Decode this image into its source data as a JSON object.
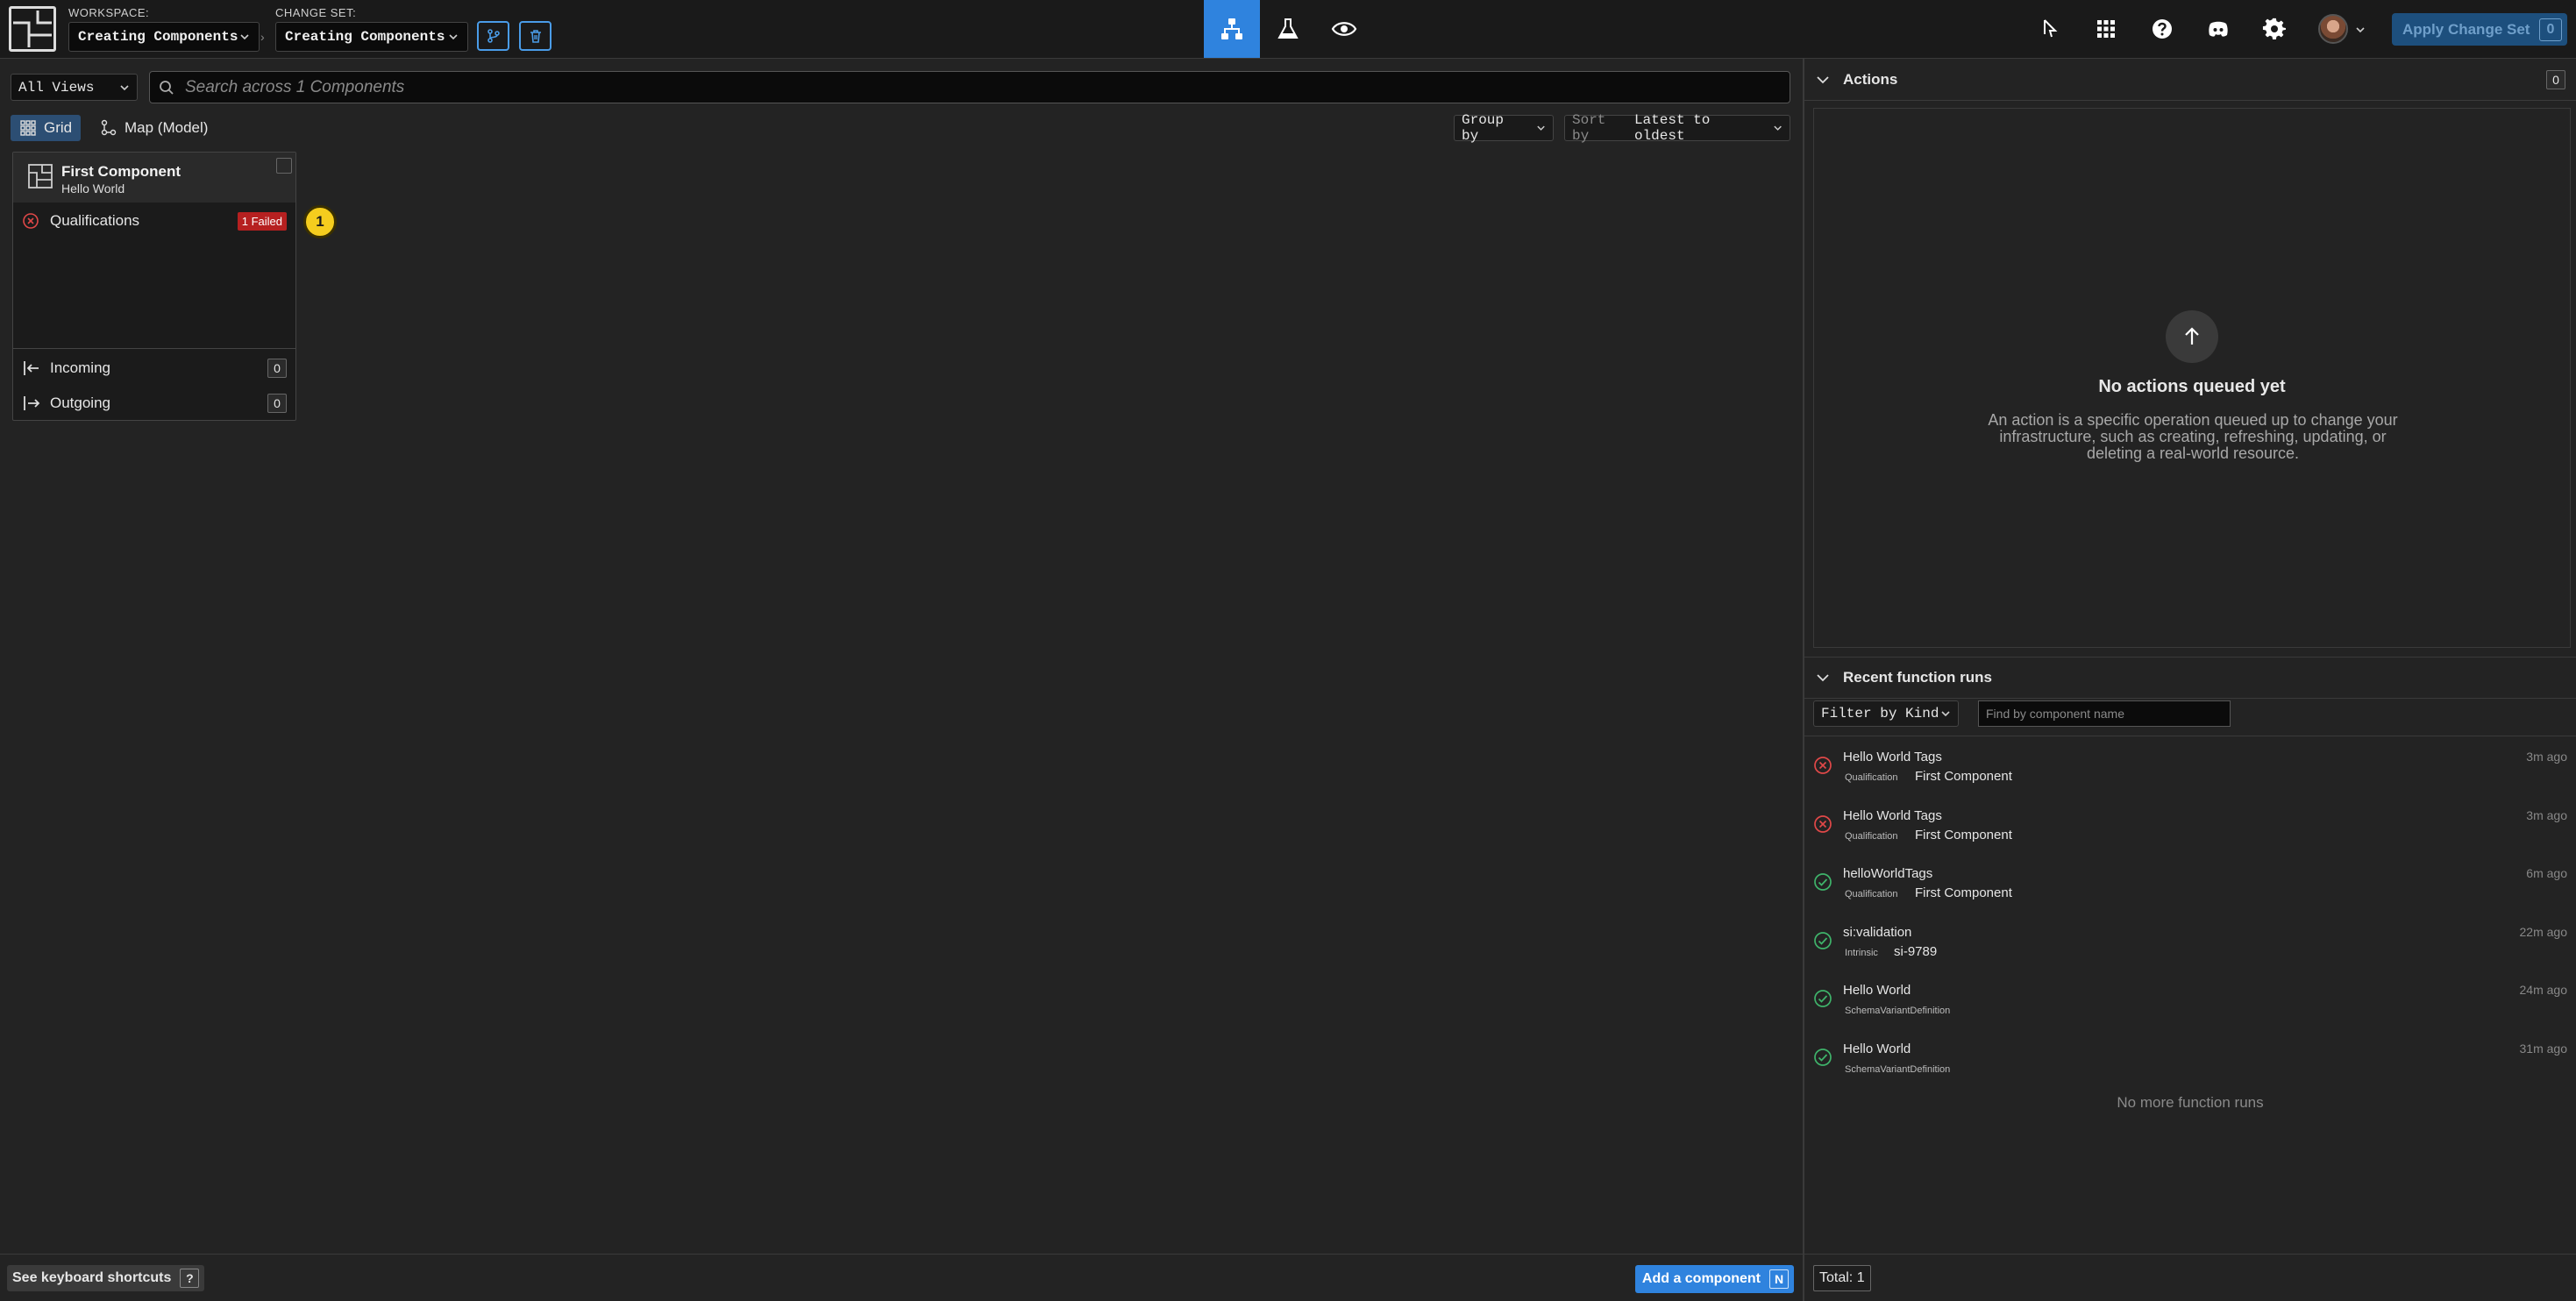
{
  "header": {
    "workspace_label": "WORKSPACE:",
    "workspace_value": "Creating Components",
    "changeset_label": "CHANGE SET:",
    "changeset_value": "Creating Components",
    "crumb_separator": "›",
    "apply_label": "Apply Change Set",
    "apply_count": "0"
  },
  "toolbar": {
    "views_value": "All Views",
    "search_placeholder": "Search across 1 Components",
    "tab_grid": "Grid",
    "tab_map": "Map (Model)",
    "group_by": "Group by",
    "sort_prefix": "Sort by",
    "sort_value": "Latest to oldest"
  },
  "component_card": {
    "title": "First Component",
    "subtitle": "Hello World",
    "qualifications_label": "Qualifications",
    "qualifications_badge": "1 Failed",
    "incoming_label": "Incoming",
    "incoming_count": "0",
    "outgoing_label": "Outgoing",
    "outgoing_count": "0",
    "bubble": "1"
  },
  "footer_left": {
    "shortcuts_label": "See keyboard shortcuts",
    "shortcuts_key": "?",
    "add_label": "Add a component",
    "add_key": "N"
  },
  "actions_panel": {
    "title": "Actions",
    "count": "0",
    "empty_title": "No actions queued yet",
    "empty_desc": "An action is a specific operation queued up to change your infrastructure, such as creating, refreshing, updating, or deleting a real-world resource."
  },
  "function_runs": {
    "title": "Recent function runs",
    "filter_label": "Filter by Kind",
    "find_placeholder": "Find by component name",
    "runs": [
      {
        "name": "Hello World Tags",
        "kind": "Qualification",
        "component": "First Component",
        "time": "3m ago",
        "status": "failed"
      },
      {
        "name": "Hello World Tags",
        "kind": "Qualification",
        "component": "First Component",
        "time": "3m ago",
        "status": "failed"
      },
      {
        "name": "helloWorldTags",
        "kind": "Qualification",
        "component": "First Component",
        "time": "6m ago",
        "status": "success"
      },
      {
        "name": "si:validation",
        "kind": "Intrinsic",
        "component": "si-9789",
        "time": "22m ago",
        "status": "success"
      },
      {
        "name": "Hello World",
        "kind": "SchemaVariantDefinition",
        "component": "",
        "time": "24m ago",
        "status": "success"
      },
      {
        "name": "Hello World",
        "kind": "SchemaVariantDefinition",
        "component": "",
        "time": "31m ago",
        "status": "success"
      }
    ],
    "no_more": "No more function runs",
    "total_label": "Total: 1"
  },
  "colors": {
    "accent": "#2f83de",
    "failed": "#e04848",
    "success": "#3fb36a",
    "badge": "#f5cd1e"
  }
}
